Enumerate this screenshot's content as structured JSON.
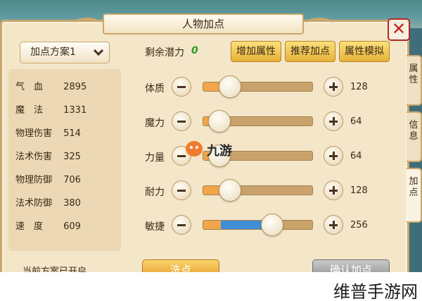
{
  "window": {
    "title": "人物加点",
    "close_label": "✕"
  },
  "scheme": {
    "label": "加点方案1"
  },
  "stats": [
    {
      "label": "气　血",
      "value": "2895"
    },
    {
      "label": "魔　法",
      "value": "1331"
    },
    {
      "label": "物理伤害",
      "value": "514"
    },
    {
      "label": "法术伤害",
      "value": "325"
    },
    {
      "label": "物理防御",
      "value": "706"
    },
    {
      "label": "法术防御",
      "value": "380"
    },
    {
      "label": "速　度",
      "value": "609"
    }
  ],
  "scheme_status": "当前方案已开启",
  "potential": {
    "label": "剩余潜力",
    "value": "0"
  },
  "actions": {
    "add_attr": "增加属性",
    "recommend": "推荐加点",
    "simulate": "属性模拟"
  },
  "attributes": [
    {
      "label": "体质",
      "value": "128",
      "base_fill": 0.16,
      "extra_fill": 0.09
    },
    {
      "label": "魔力",
      "value": "64",
      "base_fill": 0.15,
      "extra_fill": 0.0
    },
    {
      "label": "力量",
      "value": "64",
      "base_fill": 0.15,
      "extra_fill": 0.0
    },
    {
      "label": "耐力",
      "value": "128",
      "base_fill": 0.16,
      "extra_fill": 0.09
    },
    {
      "label": "敏捷",
      "value": "256",
      "base_fill": 0.16,
      "extra_fill": 0.47
    }
  ],
  "bottom": {
    "wash": "洗点",
    "confirm": "确认加点"
  },
  "side_tabs": [
    "属性",
    "信息",
    "加点"
  ],
  "watermarks": {
    "center": "九游",
    "corner": "维普手游网"
  },
  "colors": {
    "potential": "#2f9a2a",
    "fill_base": "#f1a64a",
    "fill_extra": "#3f8fd6",
    "close": "#c0261a"
  }
}
